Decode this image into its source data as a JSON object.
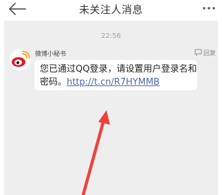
{
  "header": {
    "title": "未关注人消息",
    "back_icon": "arrow-left-icon",
    "more_icon": "more-dots-icon"
  },
  "chat": {
    "timestamp": "22:56",
    "message": {
      "sender": "微博小秘书",
      "avatar_icon": "weibo-logo-icon",
      "reply_label": "回复",
      "reply_icon": "reply-icon",
      "text_line1": "您已通过QQ登录，请设置用户登录名和",
      "text_line2_prefix": "密码。",
      "link": "http://t.cn/R7HYMMB"
    }
  },
  "colors": {
    "chat_background": "#eeeeee",
    "bubble": "#ffffff",
    "link": "#4b6aa6",
    "annotation_arrow": "#f0403c"
  }
}
